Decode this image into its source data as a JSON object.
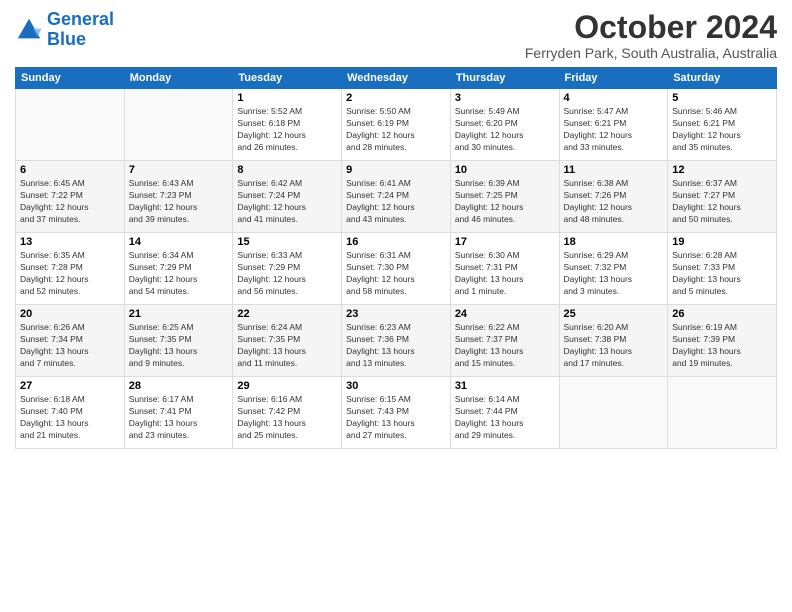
{
  "logo": {
    "line1": "General",
    "line2": "Blue"
  },
  "header": {
    "month": "October 2024",
    "location": "Ferryden Park, South Australia, Australia"
  },
  "days_of_week": [
    "Sunday",
    "Monday",
    "Tuesday",
    "Wednesday",
    "Thursday",
    "Friday",
    "Saturday"
  ],
  "weeks": [
    [
      {
        "day": "",
        "info": ""
      },
      {
        "day": "",
        "info": ""
      },
      {
        "day": "1",
        "info": "Sunrise: 5:52 AM\nSunset: 6:18 PM\nDaylight: 12 hours\nand 26 minutes."
      },
      {
        "day": "2",
        "info": "Sunrise: 5:50 AM\nSunset: 6:19 PM\nDaylight: 12 hours\nand 28 minutes."
      },
      {
        "day": "3",
        "info": "Sunrise: 5:49 AM\nSunset: 6:20 PM\nDaylight: 12 hours\nand 30 minutes."
      },
      {
        "day": "4",
        "info": "Sunrise: 5:47 AM\nSunset: 6:21 PM\nDaylight: 12 hours\nand 33 minutes."
      },
      {
        "day": "5",
        "info": "Sunrise: 5:46 AM\nSunset: 6:21 PM\nDaylight: 12 hours\nand 35 minutes."
      }
    ],
    [
      {
        "day": "6",
        "info": "Sunrise: 6:45 AM\nSunset: 7:22 PM\nDaylight: 12 hours\nand 37 minutes."
      },
      {
        "day": "7",
        "info": "Sunrise: 6:43 AM\nSunset: 7:23 PM\nDaylight: 12 hours\nand 39 minutes."
      },
      {
        "day": "8",
        "info": "Sunrise: 6:42 AM\nSunset: 7:24 PM\nDaylight: 12 hours\nand 41 minutes."
      },
      {
        "day": "9",
        "info": "Sunrise: 6:41 AM\nSunset: 7:24 PM\nDaylight: 12 hours\nand 43 minutes."
      },
      {
        "day": "10",
        "info": "Sunrise: 6:39 AM\nSunset: 7:25 PM\nDaylight: 12 hours\nand 46 minutes."
      },
      {
        "day": "11",
        "info": "Sunrise: 6:38 AM\nSunset: 7:26 PM\nDaylight: 12 hours\nand 48 minutes."
      },
      {
        "day": "12",
        "info": "Sunrise: 6:37 AM\nSunset: 7:27 PM\nDaylight: 12 hours\nand 50 minutes."
      }
    ],
    [
      {
        "day": "13",
        "info": "Sunrise: 6:35 AM\nSunset: 7:28 PM\nDaylight: 12 hours\nand 52 minutes."
      },
      {
        "day": "14",
        "info": "Sunrise: 6:34 AM\nSunset: 7:29 PM\nDaylight: 12 hours\nand 54 minutes."
      },
      {
        "day": "15",
        "info": "Sunrise: 6:33 AM\nSunset: 7:29 PM\nDaylight: 12 hours\nand 56 minutes."
      },
      {
        "day": "16",
        "info": "Sunrise: 6:31 AM\nSunset: 7:30 PM\nDaylight: 12 hours\nand 58 minutes."
      },
      {
        "day": "17",
        "info": "Sunrise: 6:30 AM\nSunset: 7:31 PM\nDaylight: 13 hours\nand 1 minute."
      },
      {
        "day": "18",
        "info": "Sunrise: 6:29 AM\nSunset: 7:32 PM\nDaylight: 13 hours\nand 3 minutes."
      },
      {
        "day": "19",
        "info": "Sunrise: 6:28 AM\nSunset: 7:33 PM\nDaylight: 13 hours\nand 5 minutes."
      }
    ],
    [
      {
        "day": "20",
        "info": "Sunrise: 6:26 AM\nSunset: 7:34 PM\nDaylight: 13 hours\nand 7 minutes."
      },
      {
        "day": "21",
        "info": "Sunrise: 6:25 AM\nSunset: 7:35 PM\nDaylight: 13 hours\nand 9 minutes."
      },
      {
        "day": "22",
        "info": "Sunrise: 6:24 AM\nSunset: 7:35 PM\nDaylight: 13 hours\nand 11 minutes."
      },
      {
        "day": "23",
        "info": "Sunrise: 6:23 AM\nSunset: 7:36 PM\nDaylight: 13 hours\nand 13 minutes."
      },
      {
        "day": "24",
        "info": "Sunrise: 6:22 AM\nSunset: 7:37 PM\nDaylight: 13 hours\nand 15 minutes."
      },
      {
        "day": "25",
        "info": "Sunrise: 6:20 AM\nSunset: 7:38 PM\nDaylight: 13 hours\nand 17 minutes."
      },
      {
        "day": "26",
        "info": "Sunrise: 6:19 AM\nSunset: 7:39 PM\nDaylight: 13 hours\nand 19 minutes."
      }
    ],
    [
      {
        "day": "27",
        "info": "Sunrise: 6:18 AM\nSunset: 7:40 PM\nDaylight: 13 hours\nand 21 minutes."
      },
      {
        "day": "28",
        "info": "Sunrise: 6:17 AM\nSunset: 7:41 PM\nDaylight: 13 hours\nand 23 minutes."
      },
      {
        "day": "29",
        "info": "Sunrise: 6:16 AM\nSunset: 7:42 PM\nDaylight: 13 hours\nand 25 minutes."
      },
      {
        "day": "30",
        "info": "Sunrise: 6:15 AM\nSunset: 7:43 PM\nDaylight: 13 hours\nand 27 minutes."
      },
      {
        "day": "31",
        "info": "Sunrise: 6:14 AM\nSunset: 7:44 PM\nDaylight: 13 hours\nand 29 minutes."
      },
      {
        "day": "",
        "info": ""
      },
      {
        "day": "",
        "info": ""
      }
    ]
  ]
}
